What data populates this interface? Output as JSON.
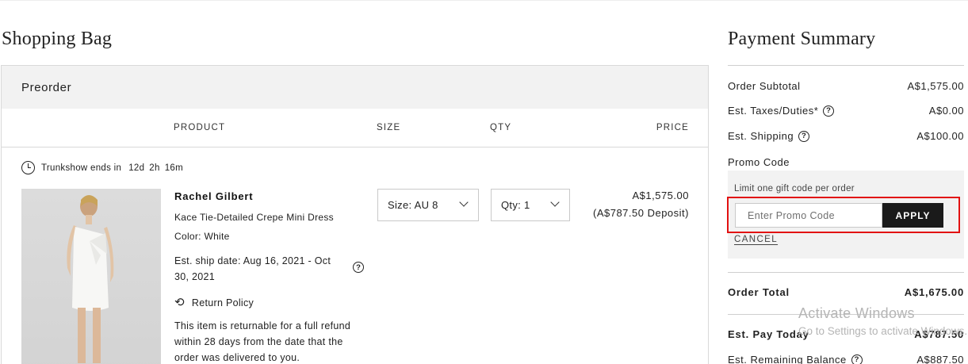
{
  "bag": {
    "title": "Shopping Bag",
    "section_title": "Preorder",
    "columns": {
      "product": "PRODUCT",
      "size": "SIZE",
      "qty": "QTY",
      "price": "PRICE"
    },
    "trunkshow": {
      "label": "Trunkshow ends in",
      "days": "12d",
      "hours": "2h",
      "minutes": "16m"
    },
    "item": {
      "brand": "Rachel Gilbert",
      "name": "Kace Tie-Detailed Crepe Mini Dress",
      "color": "Color: White",
      "ship_date": "Est. ship date: Aug 16, 2021 - Oct 30, 2021",
      "return_label": "Return Policy",
      "return_text": "This item is returnable for a full refund within 28 days from the date that the order was delivered to you.",
      "size_value": "Size: AU 8",
      "qty_value": "Qty: 1",
      "price": "A$1,575.00",
      "deposit": "(A$787.50 Deposit)"
    }
  },
  "summary": {
    "title": "Payment Summary",
    "subtotal_label": "Order Subtotal",
    "subtotal_value": "A$1,575.00",
    "taxes_label": "Est. Taxes/Duties*",
    "taxes_value": "A$0.00",
    "shipping_label": "Est. Shipping",
    "shipping_value": "A$100.00",
    "promo_label": "Promo Code",
    "promo_limit": "Limit one gift code per order",
    "promo_placeholder": "Enter Promo Code",
    "apply_label": "APPLY",
    "cancel_label": "CANCEL",
    "total_label": "Order Total",
    "total_value": "A$1,675.00",
    "pay_today_label": "Est. Pay Today",
    "pay_today_value": "A$787.50",
    "remaining_label": "Est. Remaining Balance",
    "remaining_value": "A$887.50"
  },
  "watermark": {
    "line1": "Activate Windows",
    "line2": "Go to Settings to activate Windows."
  },
  "icons": [
    "clock-icon",
    "help-icon",
    "return-policy-icon",
    "chevron-down-icon"
  ],
  "colors": {
    "highlight": "#e21111",
    "button": "#1a1a1a",
    "panel": "#f2f2f2"
  }
}
